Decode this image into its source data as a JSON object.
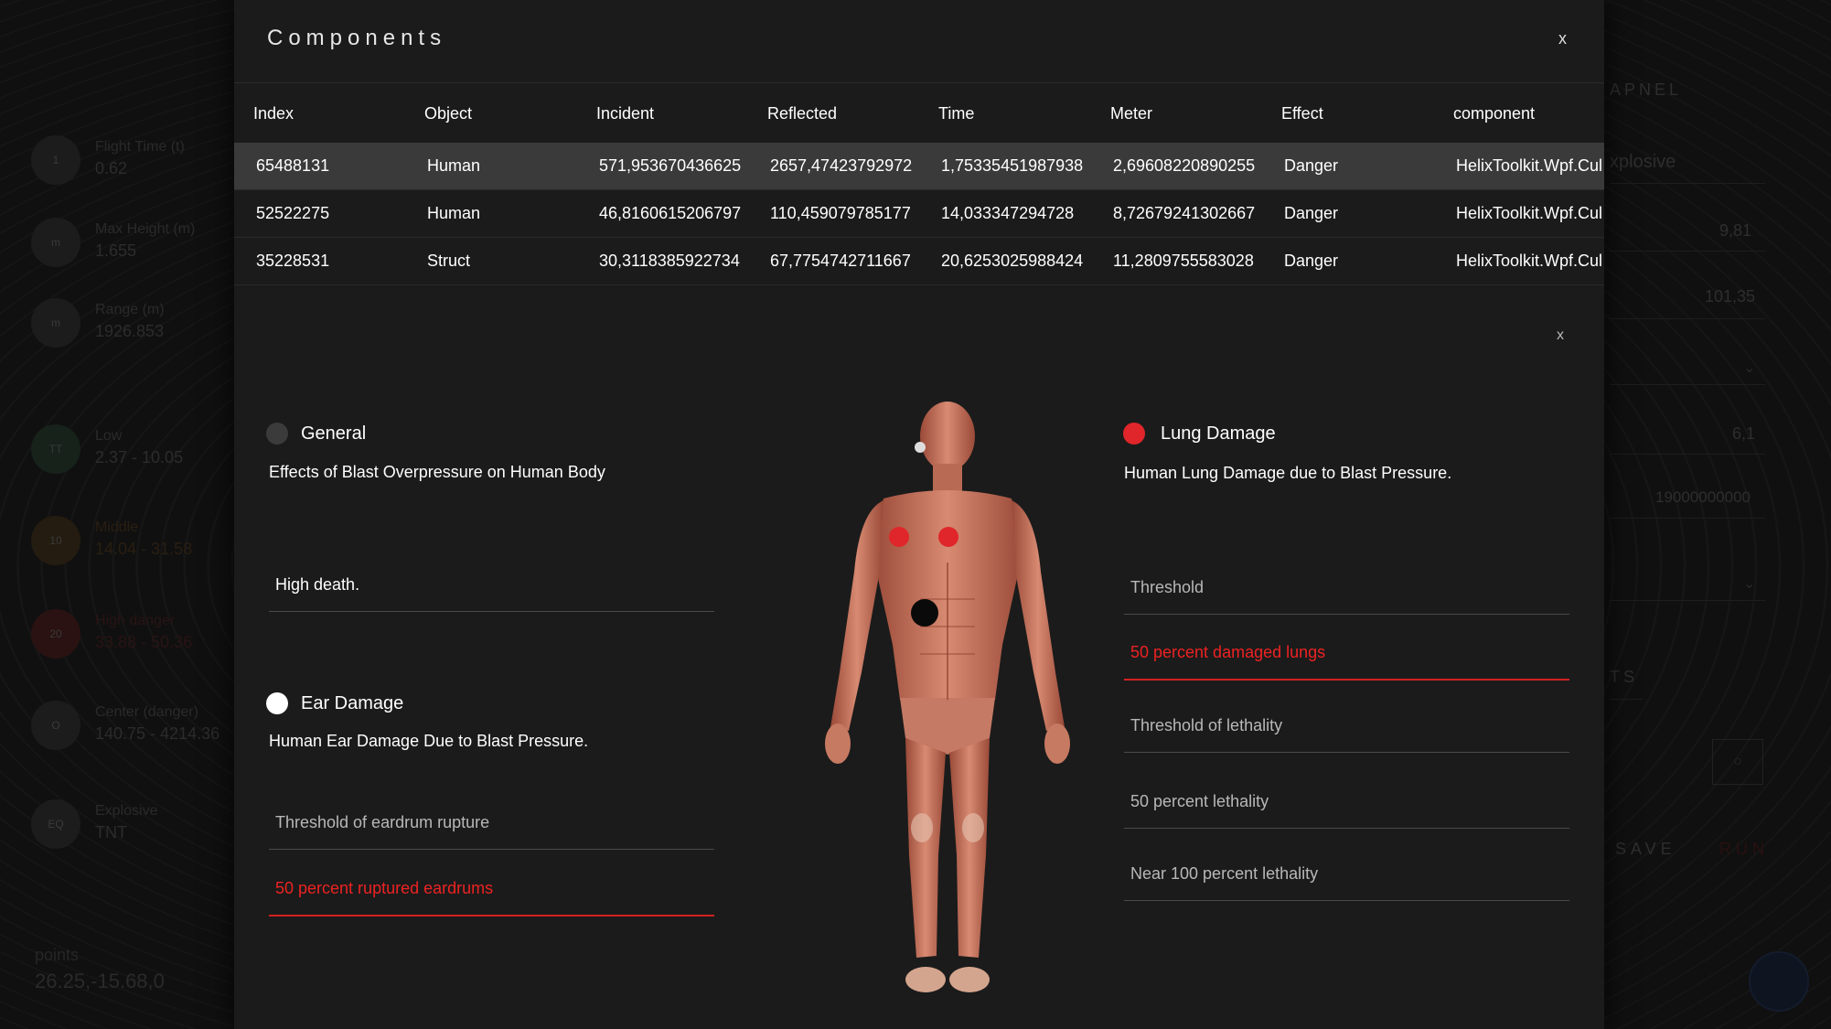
{
  "background": {
    "stats": [
      {
        "icon": "1",
        "label": "Flight Time (t)",
        "value": "0.62"
      },
      {
        "icon": "m",
        "label": "Max Height (m)",
        "value": "1.655"
      },
      {
        "icon": "m",
        "label": "Range (m)",
        "value": "1926.853"
      },
      {
        "icon": "TT",
        "label": "Low",
        "value": "2.37 - 10.05"
      },
      {
        "icon": "10",
        "label": "Middle",
        "value": "14.04 - 31.58"
      },
      {
        "icon": "20",
        "label": "High danger",
        "value": "33.88 - 50.36"
      },
      {
        "icon": "O",
        "label": "Center (danger)",
        "value": "140.75 - 4214.36"
      },
      {
        "icon": "EQ",
        "label": "Explosive",
        "value": "TNT"
      }
    ],
    "points_label": "points",
    "points_value": "26.25,-15.68,0",
    "right_panel": {
      "header": "APNEL",
      "explosive_text": "xplosive",
      "value1": "9,81",
      "value2": "101,35",
      "value3": "6,1",
      "value4": "19000000000",
      "section": "TS",
      "save_label": "SAVE",
      "run_label": "RUN"
    }
  },
  "modal": {
    "title": "Components",
    "close_label": "x",
    "table": {
      "columns": [
        "Index",
        "Object",
        "Incident",
        "Reflected",
        "Time",
        "Meter",
        "Effect",
        "component"
      ],
      "rows": [
        [
          "65488131",
          "Human",
          "571,953670436625",
          "2657,47423792972",
          "1,75335451987938",
          "2,69608220890255",
          "Danger",
          "HelixToolkit.Wpf.Cul"
        ],
        [
          "52522275",
          "Human",
          "46,8160615206797",
          "110,459079785177",
          "14,033347294728",
          "8,72679241302667",
          "Danger",
          "HelixToolkit.Wpf.Cul"
        ],
        [
          "35228531",
          "Struct",
          "30,3118385922734",
          "67,7754742711667",
          "20,6253025988424",
          "11,2809755583028",
          "Danger",
          "HelixToolkit.Wpf.Cul"
        ]
      ],
      "selected_row": 0
    },
    "detail": {
      "close_label": "x",
      "general": {
        "title": "General",
        "description": "Effects of Blast Overpressure on Human Body",
        "status_value": "High death."
      },
      "ear": {
        "title": "Ear Damage",
        "description": "Human Ear Damage Due to Blast Pressure.",
        "fields": [
          "Threshold of eardrum rupture",
          "50 percent ruptured eardrums"
        ],
        "active_field": 1
      },
      "lung": {
        "title": "Lung Damage",
        "description": "Human Lung Damage due to Blast Pressure.",
        "fields": [
          "Threshold",
          "50 percent damaged lungs",
          "Threshold of lethality",
          "50 percent lethality",
          "Near 100 percent lethality"
        ],
        "active_field": 1
      }
    }
  },
  "colors": {
    "accent_red": "#e0262a",
    "inactive_dot": "#3b3b3b",
    "active_dot_white": "#ffffff",
    "modal_bg": "#1b1b1b",
    "selected_row_bg": "#3a3a3a"
  }
}
